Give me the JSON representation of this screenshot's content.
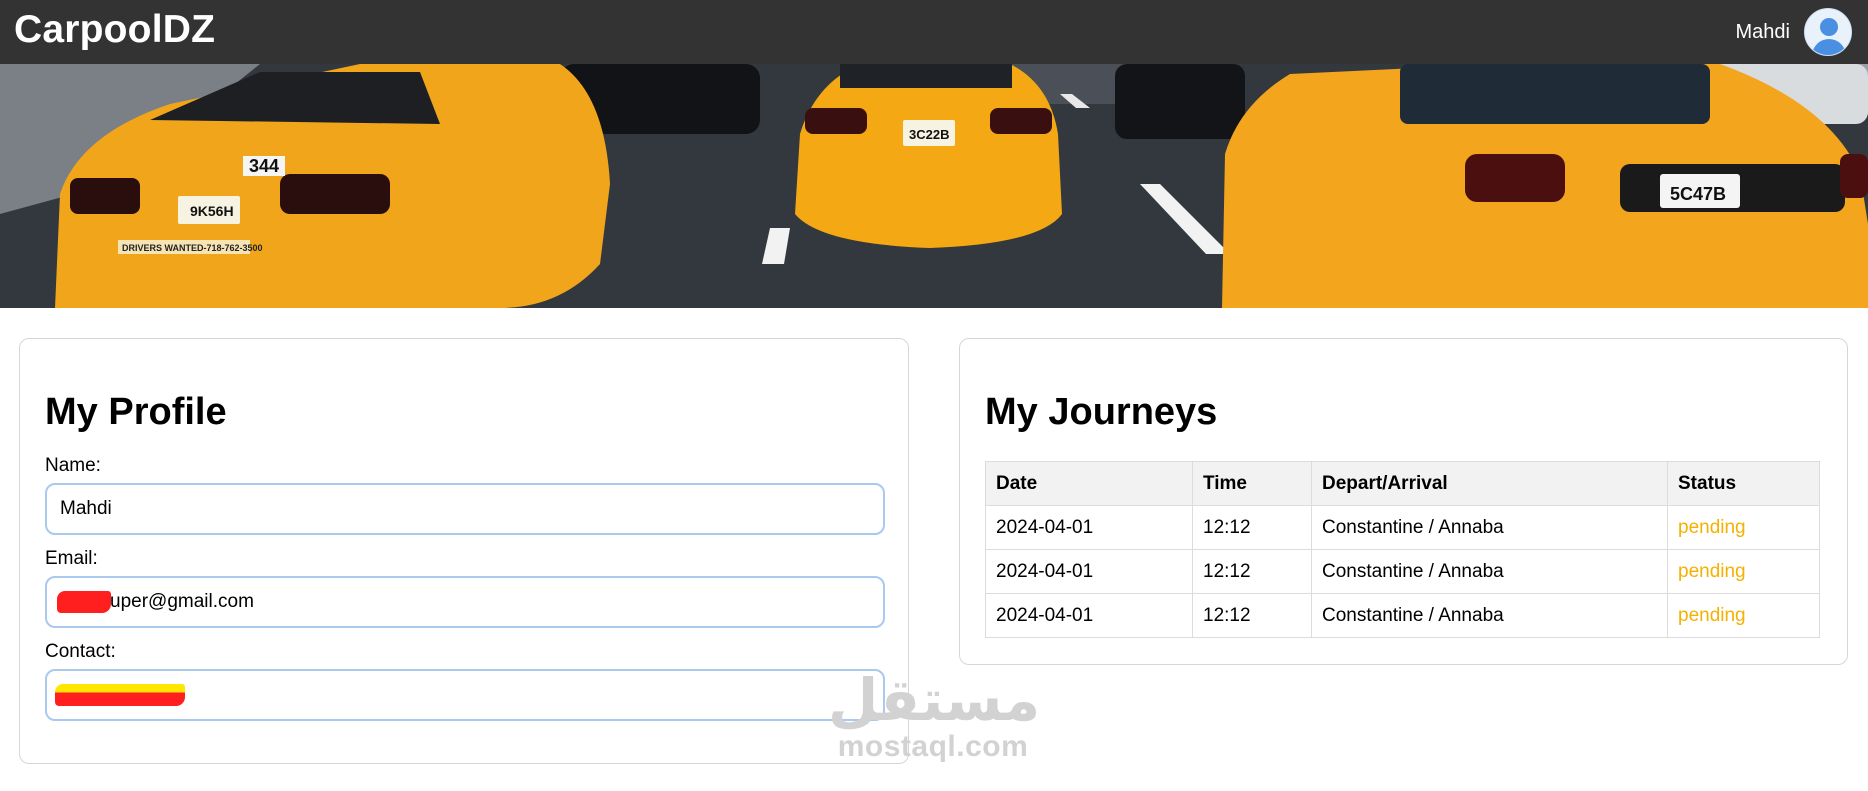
{
  "header": {
    "brand": "CarpoolDZ",
    "user_name": "Mahdi"
  },
  "hero": {
    "image": "yellow-taxi-cars-banner",
    "plates": [
      "344",
      "9K56H",
      "3C22B",
      "5C47B"
    ],
    "car_sign": "DRIVERS WANTED-718-762-3500"
  },
  "profile": {
    "title": "My Profile",
    "name_label": "Name:",
    "name_value": "Mahdi",
    "email_label": "Email:",
    "email_value": "uper@gmail.com",
    "contact_label": "Contact:",
    "contact_value": ""
  },
  "journeys": {
    "title": "My Journeys",
    "columns": [
      "Date",
      "Time",
      "Depart/Arrival",
      "Status"
    ],
    "rows": [
      {
        "date": "2024-04-01",
        "time": "12:12",
        "route": "Constantine / Annaba",
        "status": "pending"
      },
      {
        "date": "2024-04-01",
        "time": "12:12",
        "route": "Constantine / Annaba",
        "status": "pending"
      },
      {
        "date": "2024-04-01",
        "time": "12:12",
        "route": "Constantine / Annaba",
        "status": "pending"
      }
    ]
  },
  "watermark": {
    "arabic": "مستقل",
    "latin": "mostaql.com"
  },
  "colors": {
    "topbar": "#333333",
    "input_border": "#a9c9ee",
    "status_pending": "#f5b100",
    "redaction": "#ff1f1f"
  }
}
